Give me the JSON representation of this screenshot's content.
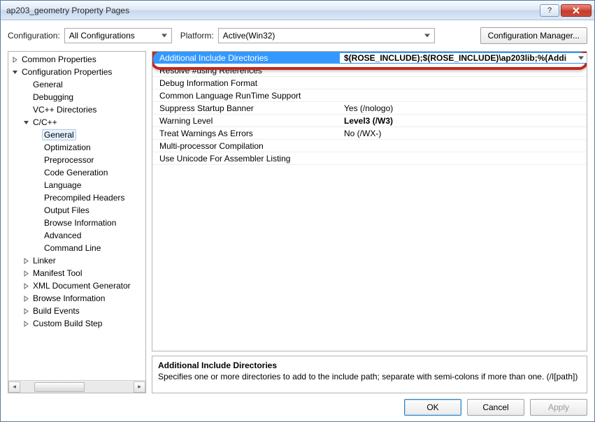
{
  "window": {
    "title": "ap203_geometry Property Pages"
  },
  "toolbar": {
    "config_label": "Configuration:",
    "config_value": "All Configurations",
    "platform_label": "Platform:",
    "platform_value": "Active(Win32)",
    "manager_label": "Configuration Manager..."
  },
  "tree": {
    "common": "Common Properties",
    "configprops": "Configuration Properties",
    "general": "General",
    "debugging": "Debugging",
    "vcdirs": "VC++ Directories",
    "ccpp": "C/C++",
    "cc_general": "General",
    "cc_opt": "Optimization",
    "cc_pre": "Preprocessor",
    "cc_codegen": "Code Generation",
    "cc_lang": "Language",
    "cc_pch": "Precompiled Headers",
    "cc_out": "Output Files",
    "cc_browse": "Browse Information",
    "cc_adv": "Advanced",
    "cc_cmd": "Command Line",
    "linker": "Linker",
    "manifest": "Manifest Tool",
    "xmldoc": "XML Document Generator",
    "browseinfo": "Browse Information",
    "buildevents": "Build Events",
    "custom": "Custom Build Step"
  },
  "props": [
    {
      "name": "Additional Include Directories",
      "value": "$(ROSE_INCLUDE);$(ROSE_INCLUDE)\\ap203lib;%(Addi",
      "selected": true,
      "boldval": true
    },
    {
      "name": "Resolve #using References",
      "value": ""
    },
    {
      "name": "Debug Information Format",
      "value": ""
    },
    {
      "name": "Common Language RunTime Support",
      "value": ""
    },
    {
      "name": "Suppress Startup Banner",
      "value": "Yes (/nologo)"
    },
    {
      "name": "Warning Level",
      "value": "Level3 (/W3)",
      "boldval": true
    },
    {
      "name": "Treat Warnings As Errors",
      "value": "No (/WX-)"
    },
    {
      "name": "Multi-processor Compilation",
      "value": ""
    },
    {
      "name": "Use Unicode For Assembler Listing",
      "value": ""
    }
  ],
  "desc": {
    "title": "Additional Include Directories",
    "text": "Specifies one or more directories to add to the include path; separate with semi-colons if more than one. (/I[path])"
  },
  "buttons": {
    "ok": "OK",
    "cancel": "Cancel",
    "apply": "Apply"
  }
}
